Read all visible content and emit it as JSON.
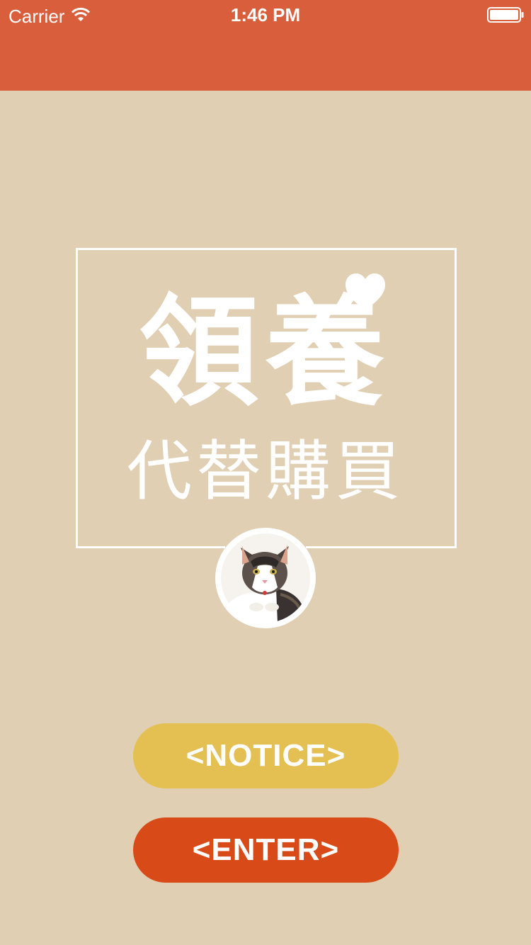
{
  "status_bar": {
    "carrier": "Carrier",
    "time": "1:46 PM",
    "icons": [
      "wifi-icon",
      "battery-icon"
    ]
  },
  "nav_bar": {
    "background_color": "#d95f3c"
  },
  "hero": {
    "title": "領養",
    "subtitle": "代替購買",
    "decoration_icon": "heart-icon",
    "avatar": "cat-photo"
  },
  "buttons": {
    "notice_label": "<NOTICE>",
    "notice_color": "#e4bf52",
    "enter_label": "<ENTER>",
    "enter_color": "#d84a18"
  },
  "colors": {
    "background": "#e0cfb3",
    "frame": "#ffffff"
  }
}
